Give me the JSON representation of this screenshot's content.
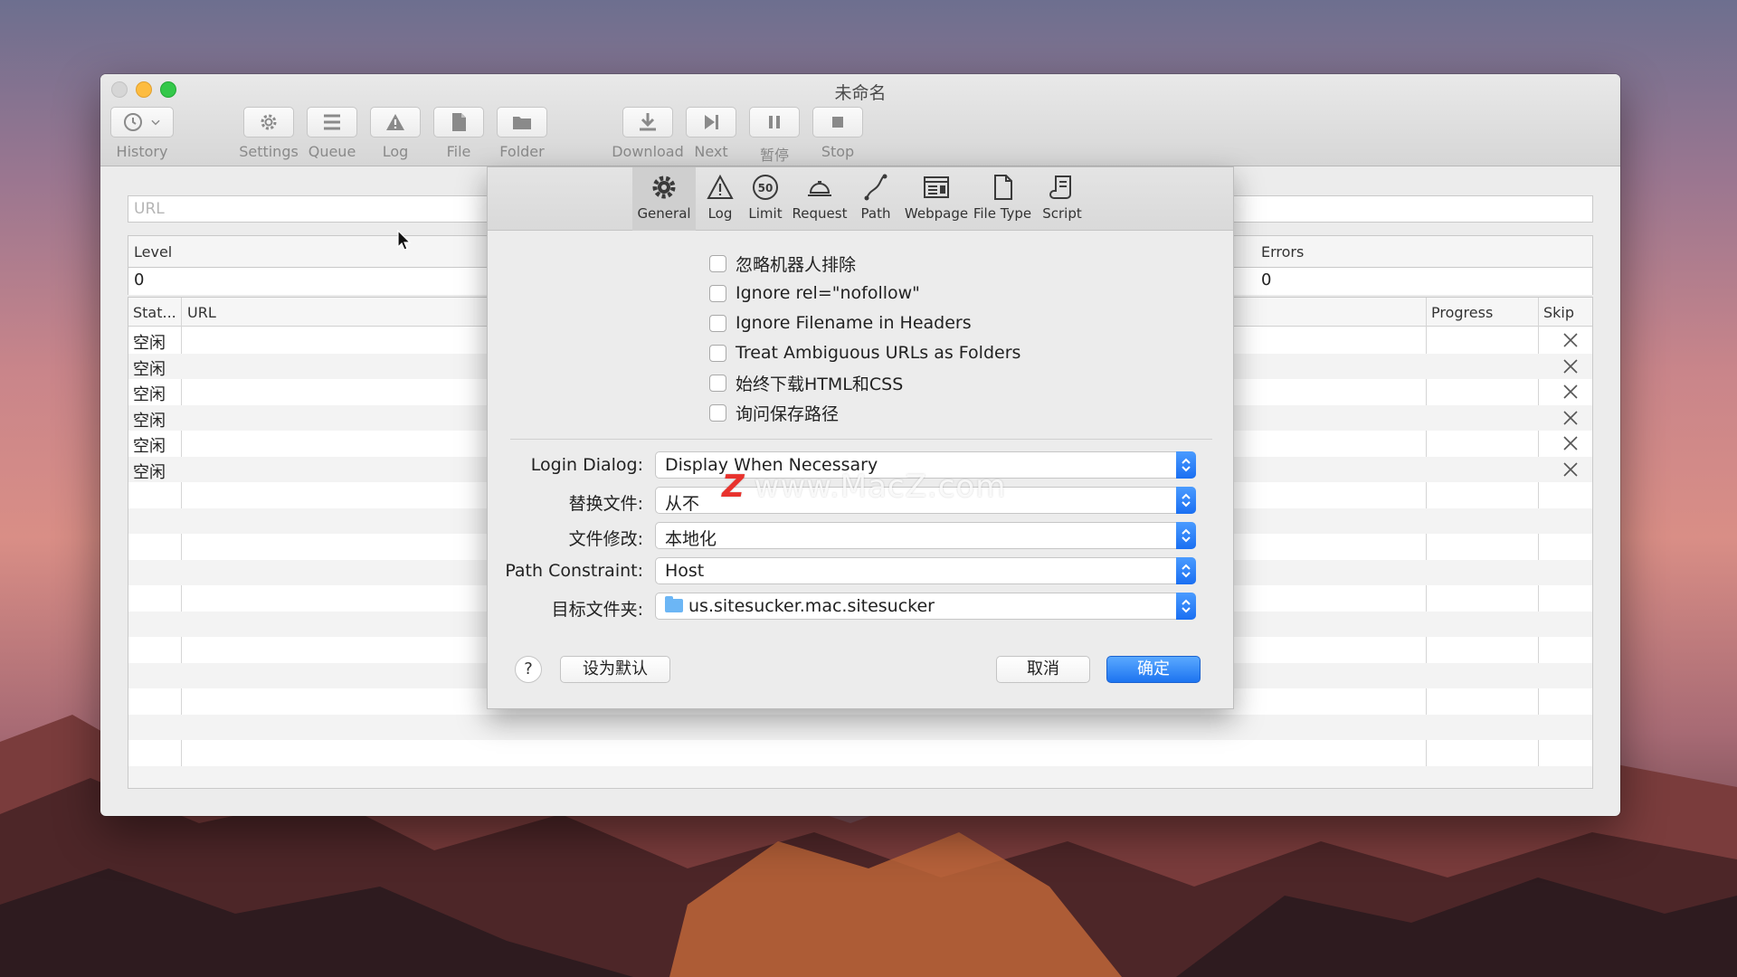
{
  "window": {
    "title": "未命名"
  },
  "toolbar": [
    {
      "label": "History",
      "icon": "clock-icon"
    },
    {
      "label": "Settings",
      "icon": "gear-icon"
    },
    {
      "label": "Queue",
      "icon": "list-icon"
    },
    {
      "label": "Log",
      "icon": "warning-icon"
    },
    {
      "label": "File",
      "icon": "document-icon"
    },
    {
      "label": "Folder",
      "icon": "folder-icon"
    },
    {
      "label": "Download",
      "icon": "download-icon"
    },
    {
      "label": "Next",
      "icon": "next-icon"
    },
    {
      "label": "暂停",
      "icon": "pause-icon"
    },
    {
      "label": "Stop",
      "icon": "stop-icon"
    }
  ],
  "main": {
    "url_placeholder": "URL",
    "stats": {
      "level_label": "Level",
      "level_value": "0",
      "errors_label": "Errors",
      "errors_value": "0"
    },
    "table": {
      "columns": [
        "Stat...",
        "URL",
        "Progress",
        "Skip"
      ],
      "rows": [
        "空闲",
        "空闲",
        "空闲",
        "空闲",
        "空闲",
        "空闲"
      ]
    }
  },
  "sheet": {
    "tabs": [
      {
        "label": "General",
        "icon": "gear-icon",
        "active": true
      },
      {
        "label": "Log",
        "icon": "warning-icon"
      },
      {
        "label": "Limit",
        "icon": "speed-limit-icon",
        "icon_text": "50"
      },
      {
        "label": "Request",
        "icon": "bell-icon"
      },
      {
        "label": "Path",
        "icon": "path-icon"
      },
      {
        "label": "Webpage",
        "icon": "webpage-icon"
      },
      {
        "label": "File Type",
        "icon": "file-type-icon"
      },
      {
        "label": "Script",
        "icon": "script-icon"
      }
    ],
    "checkboxes": [
      {
        "label": "忽略机器人排除",
        "checked": false
      },
      {
        "label": "Ignore rel=\"nofollow\"",
        "checked": false
      },
      {
        "label": "Ignore Filename in Headers",
        "checked": false
      },
      {
        "label": "Treat Ambiguous URLs as Folders",
        "checked": false
      },
      {
        "label": "始终下载HTML和CSS",
        "checked": false
      },
      {
        "label": "询问保存路径",
        "checked": false
      }
    ],
    "fields": [
      {
        "label": "Login Dialog:",
        "value": "Display When Necessary"
      },
      {
        "label": "替换文件:",
        "value": "从不"
      },
      {
        "label": "文件修改:",
        "value": "本地化"
      },
      {
        "label": "Path Constraint:",
        "value": "Host"
      },
      {
        "label": "目标文件夹:",
        "value": "us.sitesucker.mac.sitesucker"
      }
    ],
    "buttons": {
      "help": "?",
      "set_default": "设为默认",
      "cancel": "取消",
      "ok": "确定"
    }
  },
  "watermark": {
    "mark": "Z",
    "text": "www.MacZ.com"
  },
  "colors": {
    "accent": "#1d74f0",
    "window_bg": "#ececec"
  }
}
